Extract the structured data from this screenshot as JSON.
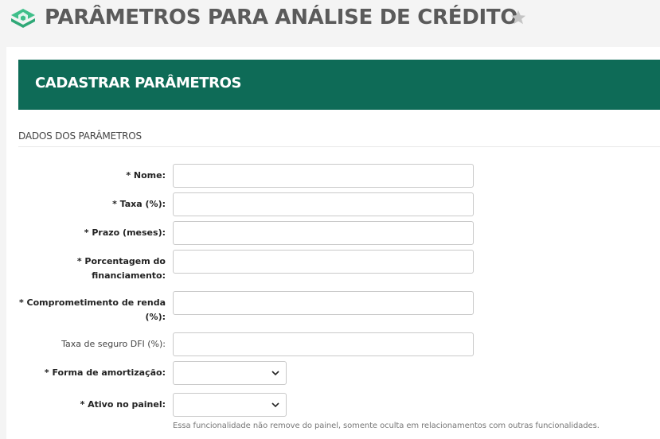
{
  "header": {
    "title": "PARÂMETROS PARA ANÁLISE DE CRÉDITO",
    "logo_icon": "houses-stack-icon",
    "favorite_icon": "star-icon"
  },
  "banner": {
    "title": "CADASTRAR PARÂMETROS"
  },
  "section": {
    "title": "DADOS DOS PARÂMETROS"
  },
  "form": {
    "nome_label": "* Nome:",
    "taxa_label": "* Taxa (%):",
    "prazo_label": "* Prazo (meses):",
    "porcentagem_label_1": "* Porcentagem do",
    "porcentagem_label_2": "financiamento:",
    "comprometimento_label_1": "* Comprometimento de renda",
    "comprometimento_label_2": "(%):",
    "seguro_label": "Taxa de seguro DFI (%):",
    "amortizacao_label": "* Forma de amortização:",
    "ativo_label": "* Ativo no painel:",
    "nome_value": "",
    "taxa_value": "",
    "prazo_value": "",
    "porcentagem_value": "",
    "comprometimento_value": "",
    "seguro_value": "",
    "amortizacao_selected": "",
    "ativo_selected": "",
    "ativo_help": "Essa funcionalidade não remove do painel, somente oculta em relacionamentos com outras funcionalidades."
  },
  "colors": {
    "brand_green": "#0e6b57",
    "logo_green": "#3fbf8a",
    "title_gray": "#5b5b5b"
  }
}
